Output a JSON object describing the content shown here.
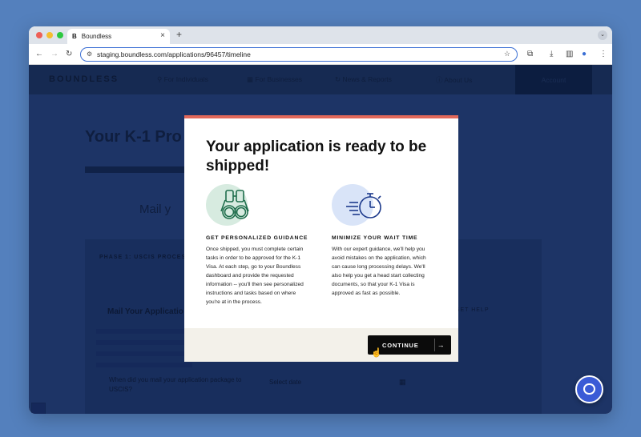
{
  "browser": {
    "tab_title": "Boundless",
    "tab_favicon": "B",
    "tab_close": "×",
    "new_tab": "+",
    "url": "staging.boundless.com/applications/96457/timeline",
    "traffic_lights": [
      "#ee5f57",
      "#f5bd2f",
      "#2cc840"
    ]
  },
  "site": {
    "logo": "BOUNDLESS",
    "nav": [
      {
        "label": "For Individuals",
        "icon": "person-icon"
      },
      {
        "label": "For Businesses",
        "icon": "building-icon"
      },
      {
        "label": "News & Reports",
        "icon": "refresh-icon"
      },
      {
        "label": "About Us",
        "icon": "info-icon"
      }
    ],
    "account": "Account",
    "bg_title": "Your K-1 Pro",
    "bg_mail": "Mail y",
    "bg_phase": "PHASE 1: USCIS PROCESSI",
    "bg_heading": "Mail Your Applicatio",
    "bg_gethelp": "GET HELP",
    "bg_question": "When did you mail your application package to USCIS?",
    "bg_date": "Select date"
  },
  "modal": {
    "title": "Your application is ready to be shipped!",
    "accent_color": "#e2685a",
    "columns": [
      {
        "icon": "binoculars-icon",
        "circle_color": "#d7ebe0",
        "heading": "GET PERSONALIZED GUIDANCE",
        "body": "Once shipped, you must complete certain tasks in order to be approved for the K-1 Visa. At each step, go to your Boundless dashboard and provide the requested information -- you'll then see personalized instructions and tasks based on where you're at in the process."
      },
      {
        "icon": "stopwatch-icon",
        "circle_color": "#d9e4f8",
        "heading": "MINIMIZE YOUR WAIT TIME",
        "body": "With our expert guidance, we'll help you avoid mistakes on the application, which can cause long processing delays. We'll also help you get a head start collecting documents, so that your K-1 Visa is approved as fast as possible."
      }
    ],
    "continue_label": "CONTINUE",
    "continue_icon": "arrow-right-icon"
  },
  "chat": {
    "icon": "chat-icon",
    "color": "#3b5bd6"
  }
}
